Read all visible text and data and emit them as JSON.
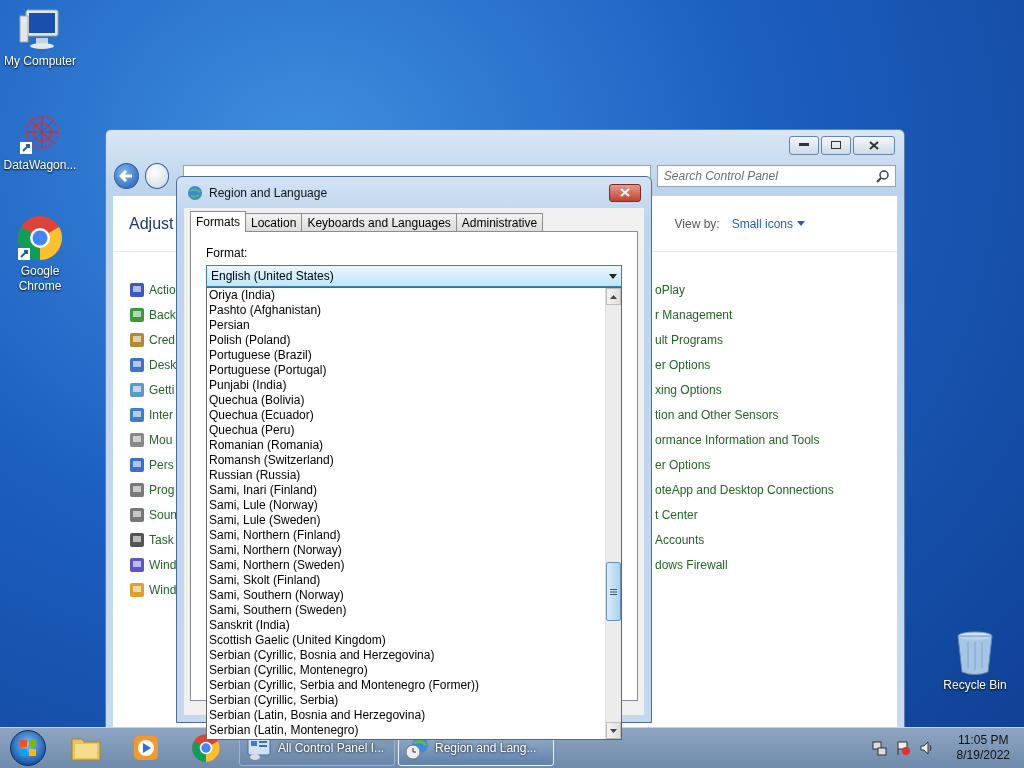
{
  "desktop_icons": [
    {
      "label": "My Computer",
      "kind": "computer"
    },
    {
      "label": "DataWagon...",
      "kind": "datawagon"
    },
    {
      "label": "Google Chrome",
      "kind": "chrome"
    },
    {
      "label": "Recycle Bin",
      "kind": "recycle"
    }
  ],
  "control_panel": {
    "search": {
      "placeholder": "Search Control Panel"
    },
    "heading": "Adjust",
    "view_by": {
      "label": "View by:",
      "value": "Small icons"
    },
    "left_items": [
      "Actio",
      "Back",
      "Cred",
      "Desk",
      "Getti",
      "Inter",
      "Mou",
      "Pers",
      "Prog",
      "Soun",
      "Task",
      "Wind",
      "Wind"
    ],
    "right_items": [
      "oPlay",
      "r Management",
      "ult Programs",
      "er Options",
      "xing Options",
      "tion and Other Sensors",
      "ormance Information and Tools",
      "er Options",
      "oteApp and Desktop Connections",
      "t Center",
      "Accounts",
      "dows Firewall"
    ]
  },
  "dialog": {
    "title": "Region and Language",
    "tabs": [
      {
        "label": "Formats",
        "selected": true
      },
      {
        "label": "Location",
        "selected": false
      },
      {
        "label": "Keyboards and Languages",
        "selected": false
      },
      {
        "label": "Administrative",
        "selected": false
      }
    ],
    "format_label": "Format:",
    "format_value": "English (United States)",
    "options": [
      "Oriya (India)",
      "Pashto (Afghanistan)",
      "Persian",
      "Polish (Poland)",
      "Portuguese (Brazil)",
      "Portuguese (Portugal)",
      "Punjabi (India)",
      "Quechua (Bolivia)",
      "Quechua (Ecuador)",
      "Quechua (Peru)",
      "Romanian (Romania)",
      "Romansh (Switzerland)",
      "Russian (Russia)",
      "Sami, Inari (Finland)",
      "Sami, Lule (Norway)",
      "Sami, Lule (Sweden)",
      "Sami, Northern (Finland)",
      "Sami, Northern (Norway)",
      "Sami, Northern (Sweden)",
      "Sami, Skolt (Finland)",
      "Sami, Southern (Norway)",
      "Sami, Southern (Sweden)",
      "Sanskrit (India)",
      "Scottish Gaelic (United Kingdom)",
      "Serbian (Cyrillic, Bosnia and Herzegovina)",
      "Serbian (Cyrillic, Montenegro)",
      "Serbian (Cyrillic, Serbia and Montenegro (Former))",
      "Serbian (Cyrillic, Serbia)",
      "Serbian (Latin, Bosnia and Herzegovina)",
      "Serbian (Latin, Montenegro)"
    ]
  },
  "taskbar": {
    "pinned": [
      {
        "kind": "explorer"
      },
      {
        "kind": "media"
      },
      {
        "kind": "chrome"
      }
    ],
    "tasks": [
      {
        "label": "All Control Panel I...",
        "kind": "control-panel",
        "selected": false
      },
      {
        "label": "Region and Lang...",
        "kind": "region",
        "selected": true
      }
    ],
    "clock": {
      "time": "11:05 PM",
      "date": "8/19/2022"
    }
  }
}
